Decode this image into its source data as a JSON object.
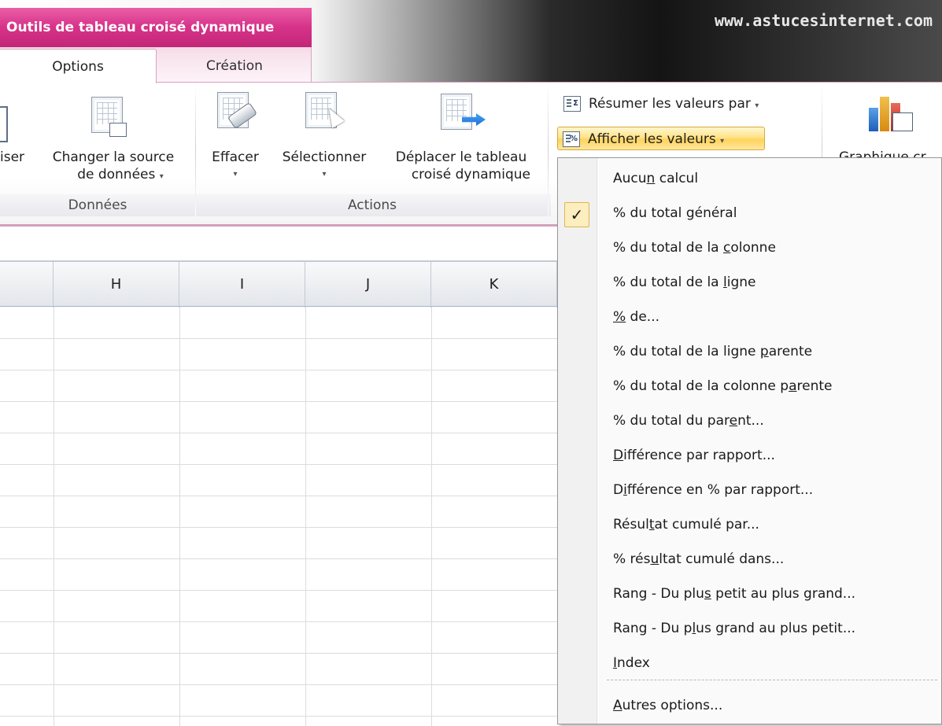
{
  "context_tab": {
    "title": "Outils de tableau croisé dynamique"
  },
  "watermark": "www.astucesinternet.com",
  "tabs": [
    {
      "label": "Options",
      "active": true
    },
    {
      "label": "Création",
      "active": false
    }
  ],
  "ribbon": {
    "partial_button": "iser",
    "changer_source": {
      "line1": "Changer la source",
      "line2": "de données"
    },
    "effacer": "Effacer",
    "selectionner": "Sélectionner",
    "deplacer": {
      "line1": "Déplacer le tableau",
      "line2": "croisé dynamique"
    },
    "resumer": "Résumer les valeurs par",
    "afficher": "Afficher les valeurs",
    "graphique_partial": "Graphique cr",
    "groups": {
      "donnees": "Données",
      "actions": "Actions"
    },
    "dropdown_glyph": "▾"
  },
  "sheet": {
    "columns": [
      "H",
      "I",
      "J",
      "K"
    ]
  },
  "menu": {
    "checkmark": "✓",
    "items": [
      {
        "pre": "Aucu",
        "acc": "n",
        "post": " calcul"
      },
      {
        "pre": "% du total ",
        "acc": "g",
        "post": "énéral",
        "checked": true
      },
      {
        "pre": "% du total de la ",
        "acc": "c",
        "post": "olonne"
      },
      {
        "pre": "% du total de la ",
        "acc": "l",
        "post": "igne"
      },
      {
        "pre": "",
        "acc": "%",
        "post": " de..."
      },
      {
        "pre": "% du total de la ligne ",
        "acc": "p",
        "post": "arente"
      },
      {
        "pre": "% du total de la colonne p",
        "acc": "a",
        "post": "rente"
      },
      {
        "pre": "% du total du par",
        "acc": "e",
        "post": "nt..."
      },
      {
        "pre": "",
        "acc": "D",
        "post": "ifférence par rapport..."
      },
      {
        "pre": "D",
        "acc": "i",
        "post": "fférence en % par rapport..."
      },
      {
        "pre": "Résul",
        "acc": "t",
        "post": "at cumulé par..."
      },
      {
        "pre": "% rés",
        "acc": "u",
        "post": "ltat cumulé dans..."
      },
      {
        "pre": "Rang - Du plu",
        "acc": "s",
        "post": " petit au plus grand..."
      },
      {
        "pre": "Rang - Du p",
        "acc": "l",
        "post": "us grand au plus petit..."
      },
      {
        "pre": "",
        "acc": "I",
        "post": "ndex"
      },
      {
        "pre": "",
        "acc": "A",
        "post": "utres options..."
      }
    ]
  },
  "colors": {
    "context_pink": "#d7338a",
    "highlight": "#ffe48a",
    "grid": "#dadcdd"
  }
}
